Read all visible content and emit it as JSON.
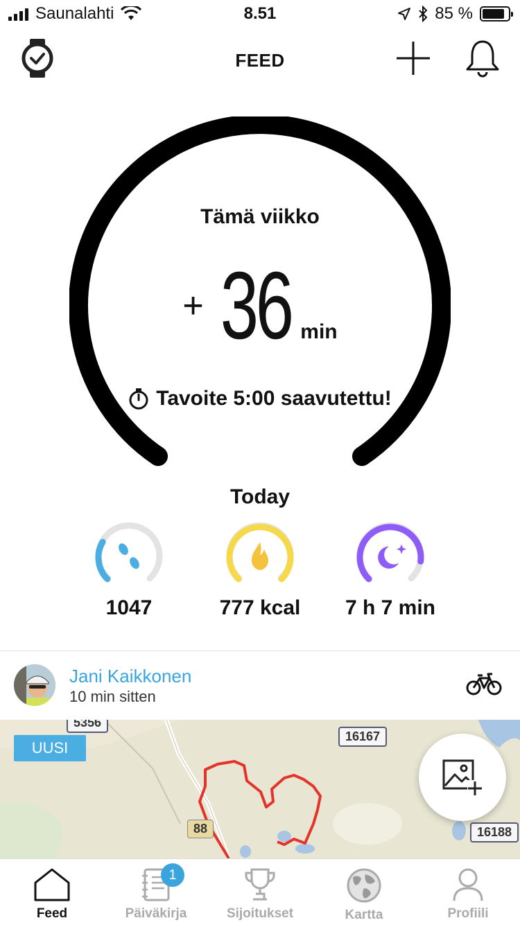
{
  "status_bar": {
    "carrier": "Saunalahti",
    "time": "8.51",
    "battery_text": "85 %",
    "battery_level": 0.85
  },
  "header": {
    "title": "FEED"
  },
  "week": {
    "label": "Tämä viikko",
    "sign": "+",
    "value": "36",
    "unit": "min",
    "goal_text": "Tavoite 5:00 saavutettu!"
  },
  "today": {
    "title": "Today",
    "stats": [
      {
        "icon": "steps-icon",
        "value": "1047",
        "color": "#4aaee3",
        "fraction": 0.28
      },
      {
        "icon": "flame-icon",
        "value": "777 kcal",
        "color": "#f5d94b",
        "fraction": 1.0
      },
      {
        "icon": "moon-icon",
        "value": "7 h 7 min",
        "color": "#8e5cf7",
        "fraction": 0.86
      }
    ]
  },
  "feed_item": {
    "user_name": "Jani Kaikkonen",
    "time_ago": "10 min sitten",
    "activity_icon": "bicycle-icon",
    "new_badge": "UUSI",
    "map": {
      "road_labels": [
        "16167",
        "88",
        "16188"
      ]
    }
  },
  "tabbar": {
    "tabs": [
      {
        "label": "Feed",
        "icon": "home-icon",
        "active": true
      },
      {
        "label": "Päiväkirja",
        "icon": "diary-icon",
        "badge": "1"
      },
      {
        "label": "Sijoitukset",
        "icon": "trophy-icon"
      },
      {
        "label": "Kartta",
        "icon": "globe-icon"
      },
      {
        "label": "Profiili",
        "icon": "person-icon"
      }
    ]
  },
  "colors": {
    "accent": "#3aa4dd",
    "route": "#e4332a",
    "map_bg": "#ede8d8"
  }
}
